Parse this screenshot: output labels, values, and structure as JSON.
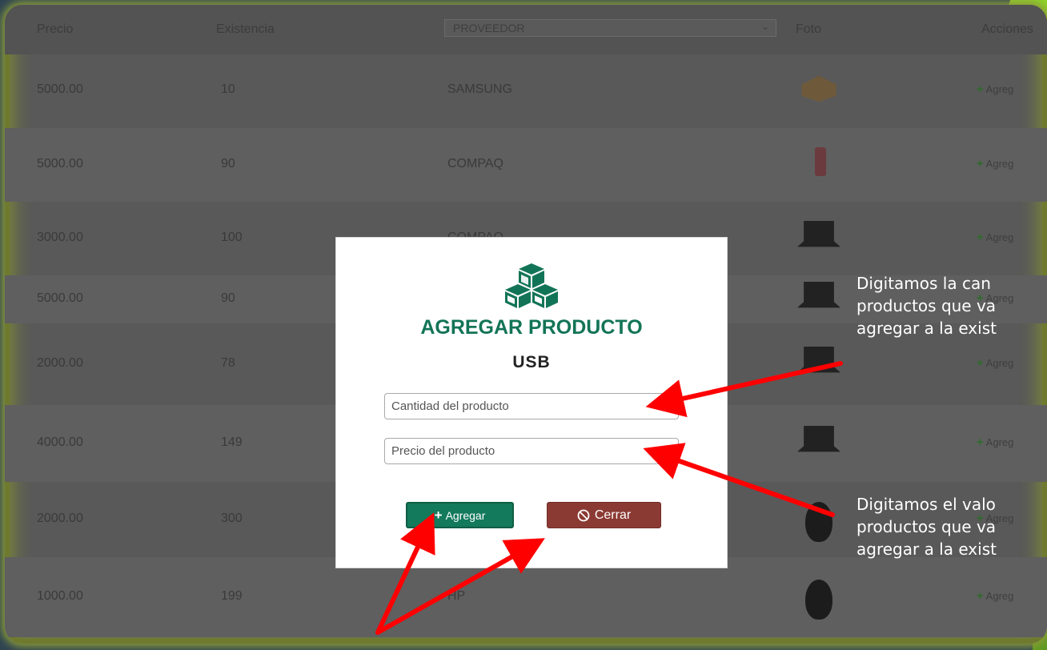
{
  "table": {
    "headers": {
      "precio": "Precio",
      "existencia": "Existencia",
      "proveedor": "PROVEEDOR",
      "foto": "Foto",
      "acciones": "Acciones"
    },
    "rows": [
      {
        "precio": "5000.00",
        "existencia": "10",
        "proveedor": "SAMSUNG",
        "foto": "box-icon",
        "accion": "Agreg"
      },
      {
        "precio": "5000.00",
        "existencia": "90",
        "proveedor": "COMPAQ",
        "foto": "bottle-icon",
        "accion": "Agreg"
      },
      {
        "precio": "3000.00",
        "existencia": "100",
        "proveedor": "COMPAQ",
        "foto": "laptop-icon",
        "accion": "Agreg"
      },
      {
        "precio": "5000.00",
        "existencia": "90",
        "proveedor": "",
        "foto": "laptop-icon",
        "accion": "Agreg"
      },
      {
        "precio": "2000.00",
        "existencia": "78",
        "proveedor": "",
        "foto": "laptop-icon",
        "accion": "Agreg"
      },
      {
        "precio": "4000.00",
        "existencia": "149",
        "proveedor": "",
        "foto": "laptop-icon",
        "accion": "Agreg"
      },
      {
        "precio": "2000.00",
        "existencia": "300",
        "proveedor": "",
        "foto": "mouse-icon",
        "accion": "Agreg"
      },
      {
        "precio": "1000.00",
        "existencia": "199",
        "proveedor": "HP",
        "foto": "mouse-icon",
        "accion": "Agreg"
      }
    ]
  },
  "modal": {
    "icon": "cubes-icon",
    "title": "AGREGAR PRODUCTO",
    "product_name": "USB",
    "quantity_placeholder": "Cantidad del producto",
    "price_placeholder": "Precio del producto",
    "add_label": "Agregar",
    "close_label": "Cerrar",
    "title_color": "#127456",
    "add_color": "#137a5b",
    "close_color": "#8b3a33"
  },
  "annotations": {
    "quantity_note": "Digitamos la can\nproductos que va\nagregar a la exist",
    "price_note": "Digitamos el valo\nproductos que va\nagregar a la exist",
    "arrow_color": "#ff0000"
  }
}
